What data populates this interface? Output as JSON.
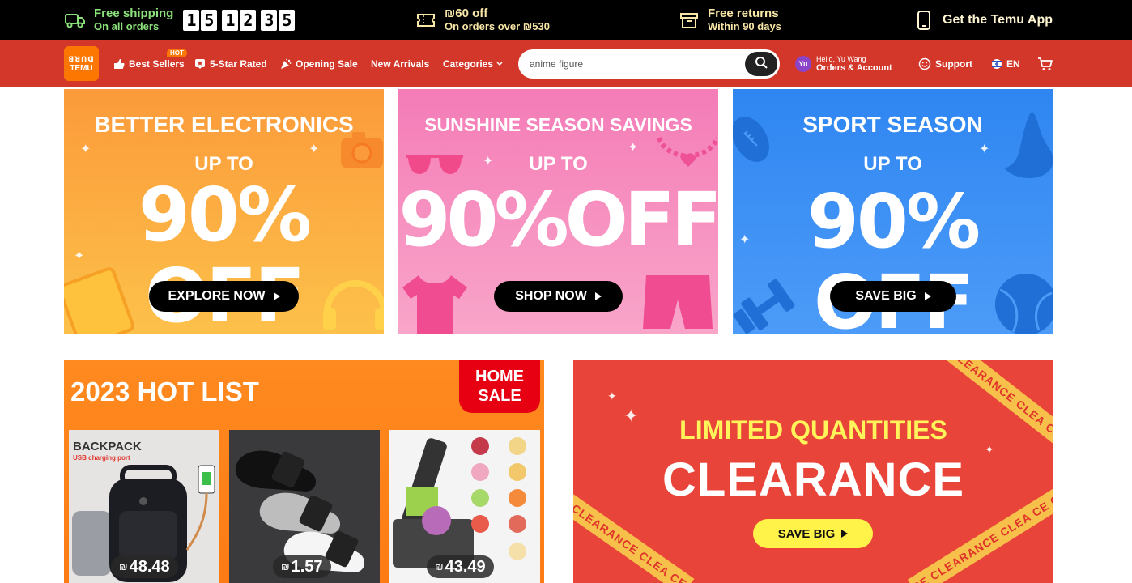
{
  "promo_bar": {
    "shipping": {
      "line1": "Free shipping",
      "line2": "On all orders",
      "icon": "truck-icon"
    },
    "timer": {
      "digits": [
        "1",
        "5",
        "1",
        "2",
        "3",
        "5"
      ]
    },
    "coupon": {
      "line1": "₪60 off",
      "line2": "On orders over ₪530",
      "icon": "ticket-icon"
    },
    "returns": {
      "line1": "Free returns",
      "line2": "Within 90 days",
      "icon": "box-icon"
    },
    "app": {
      "label": "Get the Temu App",
      "icon": "phone-icon"
    }
  },
  "nav": {
    "logo": {
      "line1": "ꓭꓤꓵꓷ",
      "line2": "TEMU"
    },
    "links": {
      "best_sellers": "Best Sellers",
      "hot_badge": "HOT",
      "five_star": "5-Star Rated",
      "opening_sale": "Opening Sale",
      "new_arrivals": "New Arrivals",
      "categories": "Categories"
    },
    "search": {
      "value": "anime figure"
    },
    "account": {
      "avatar": "Yu",
      "greeting": "Hello, Yu Wang",
      "label": "Orders & Account"
    },
    "support": "Support",
    "language": "EN"
  },
  "banners": {
    "electronics": {
      "title": "BETTER ELECTRONICS",
      "upto": "UP TO",
      "big": "90% OFF",
      "button": "EXPLORE NOW"
    },
    "sunshine": {
      "title": "SUNSHINE SEASON SAVINGS",
      "upto": "UP TO",
      "big": "90%OFF",
      "button": "SHOP NOW"
    },
    "sport": {
      "title": "SPORT SEASON",
      "upto": "UP TO",
      "big": "90% OFF",
      "button": "SAVE BIG"
    }
  },
  "hot_list": {
    "title": "2023 HOT LIST",
    "home_sale": [
      "HOME",
      "SALE"
    ],
    "products": [
      {
        "label": "BACKPACK",
        "sublabel": "USB charging port",
        "currency": "₪",
        "price": "48.48"
      },
      {
        "currency": "₪",
        "price": "1.57"
      },
      {
        "currency": "₪",
        "price": "43.49"
      }
    ]
  },
  "clearance": {
    "subtitle": "LIMITED QUANTITIES",
    "title": "CLEARANCE",
    "button": "SAVE BIG",
    "tape_text": "CE CLEARANCE CLEA"
  },
  "colors": {
    "nav_bg": "#d2372a",
    "brand_orange": "#fb7701",
    "promo_green": "#8be27a",
    "electronics_bg": "#fca73a",
    "sunshine_bg": "#f68fbf",
    "sport_bg": "#3c8ef5",
    "clearance_bg": "#e8443a"
  }
}
